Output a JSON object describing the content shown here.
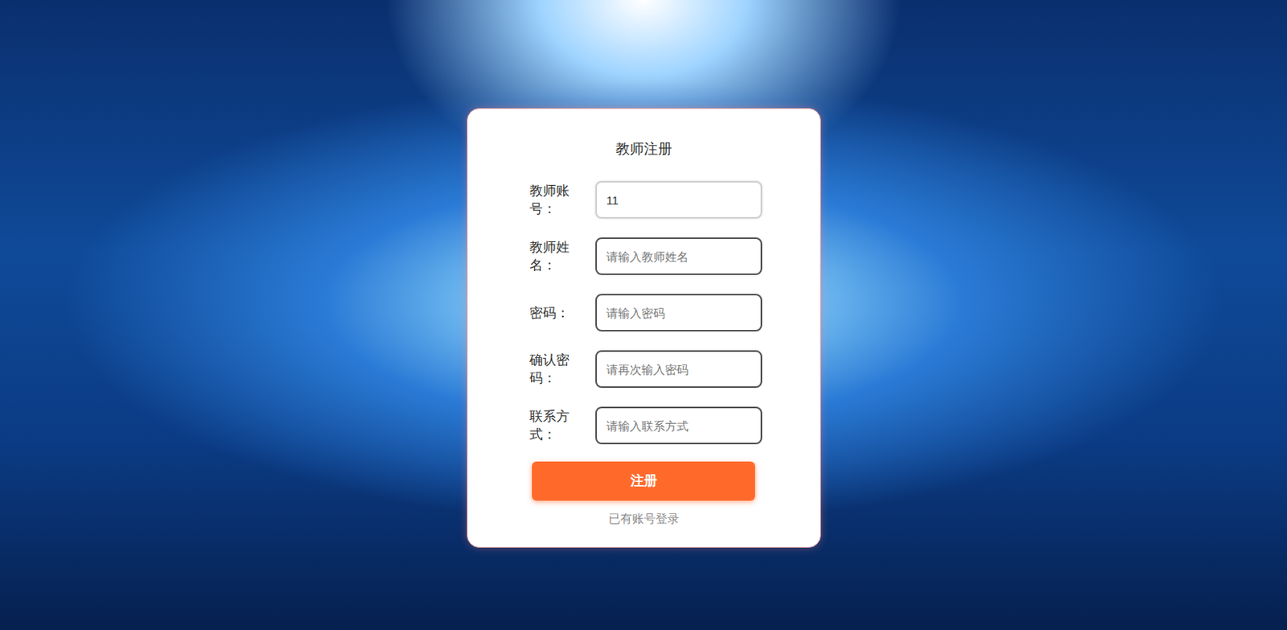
{
  "form": {
    "title": "教师注册",
    "fields": [
      {
        "label": "教师账号：",
        "placeholder": "",
        "value": "11",
        "focused": true
      },
      {
        "label": "教师姓名：",
        "placeholder": "请输入教师姓名",
        "value": "",
        "focused": false
      },
      {
        "label": "密码：",
        "placeholder": "请输入密码",
        "value": "",
        "focused": false
      },
      {
        "label": "确认密码：",
        "placeholder": "请再次输入密码",
        "value": "",
        "focused": false
      },
      {
        "label": "联系方式：",
        "placeholder": "请输入联系方式",
        "value": "",
        "focused": false
      }
    ],
    "submit": "注册",
    "login_link": "已有账号登录"
  }
}
